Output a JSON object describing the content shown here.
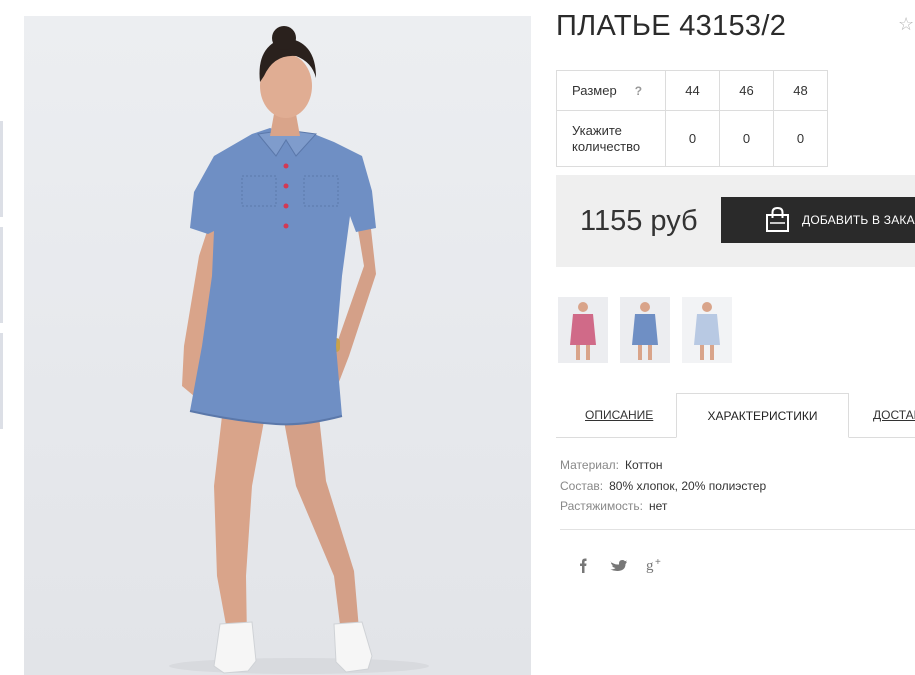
{
  "product": {
    "title": "ПЛАТЬЕ 43153/2",
    "favorite_icon": "star-outline-icon"
  },
  "size_table": {
    "size_label": "Размер",
    "help_mark": "?",
    "sizes": [
      "44",
      "46",
      "48"
    ],
    "qty_label": "Укажите количество",
    "quantities": [
      "0",
      "0",
      "0"
    ]
  },
  "purchase": {
    "price": "1155 руб",
    "add_to_cart_label": "ДОБАВИТЬ В ЗАКАЗ",
    "cart_icon": "shopping-bag-icon",
    "accent_color": "#2a2a2a"
  },
  "color_variants": [
    {
      "name": "pink",
      "color": "#d06a88"
    },
    {
      "name": "blue",
      "color": "#6f8fc4"
    },
    {
      "name": "light-blue",
      "color": "#b8c9e3"
    }
  ],
  "tabs": [
    {
      "label": "ОПИСАНИЕ",
      "active": false
    },
    {
      "label": "ХАРАКТЕРИСТИКИ",
      "active": true
    },
    {
      "label": "ДОСТАВКА",
      "active": false
    }
  ],
  "specs": [
    {
      "key": "Материал:",
      "value": "Коттон"
    },
    {
      "key": "Состав:",
      "value": "80% хлопок, 20% полиэстер"
    },
    {
      "key": "Растяжимость:",
      "value": "нет"
    }
  ],
  "social": [
    "facebook-icon",
    "twitter-icon",
    "google-plus-icon"
  ]
}
